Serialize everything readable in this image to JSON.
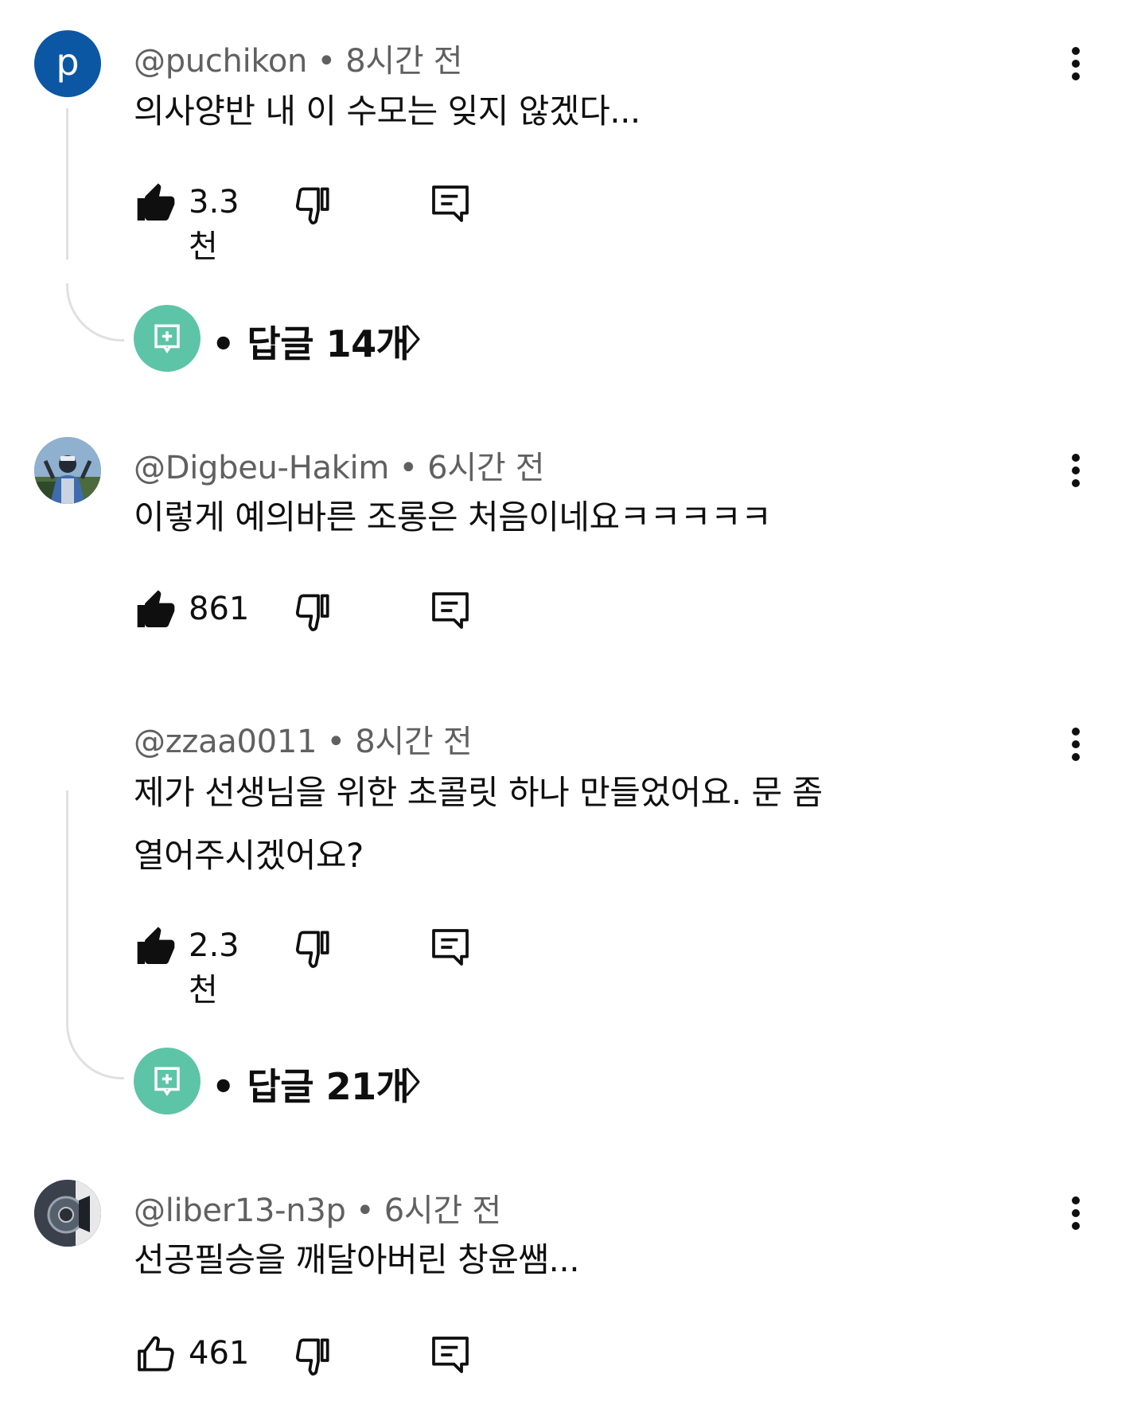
{
  "comments": [
    {
      "handle": "@puchikon",
      "time": "8시간 전",
      "text": "의사양반 내 이 수모는 잊지 않겠다...",
      "likes": "3.3천",
      "liked": true,
      "replies": "답글 14개",
      "avatar_letter": "p"
    },
    {
      "handle": "@Digbeu-Hakim",
      "time": "6시간 전",
      "text": "이렇게 예의바른 조롱은 처음이네요ㅋㅋㅋㅋㅋ",
      "likes": "861",
      "liked": true
    },
    {
      "handle": "@zzaa0011",
      "time": "8시간 전",
      "text_line1": "제가 선생님을 위한 초콜릿 하나 만들었어요. 문 좀",
      "text_line2": "열어주시겠어요?",
      "likes": "2.3천",
      "liked": true,
      "replies": "답글 21개"
    },
    {
      "handle": "@liber13-n3p",
      "time": "6시간 전",
      "text": "선공필승을 깨달아버린 창윤쌤...",
      "likes": "461",
      "liked": false
    }
  ],
  "separator": "•",
  "colors": {
    "avatar_p": "#0b57a3",
    "reply_badge": "#5ec4a7",
    "meta": "#606060"
  }
}
